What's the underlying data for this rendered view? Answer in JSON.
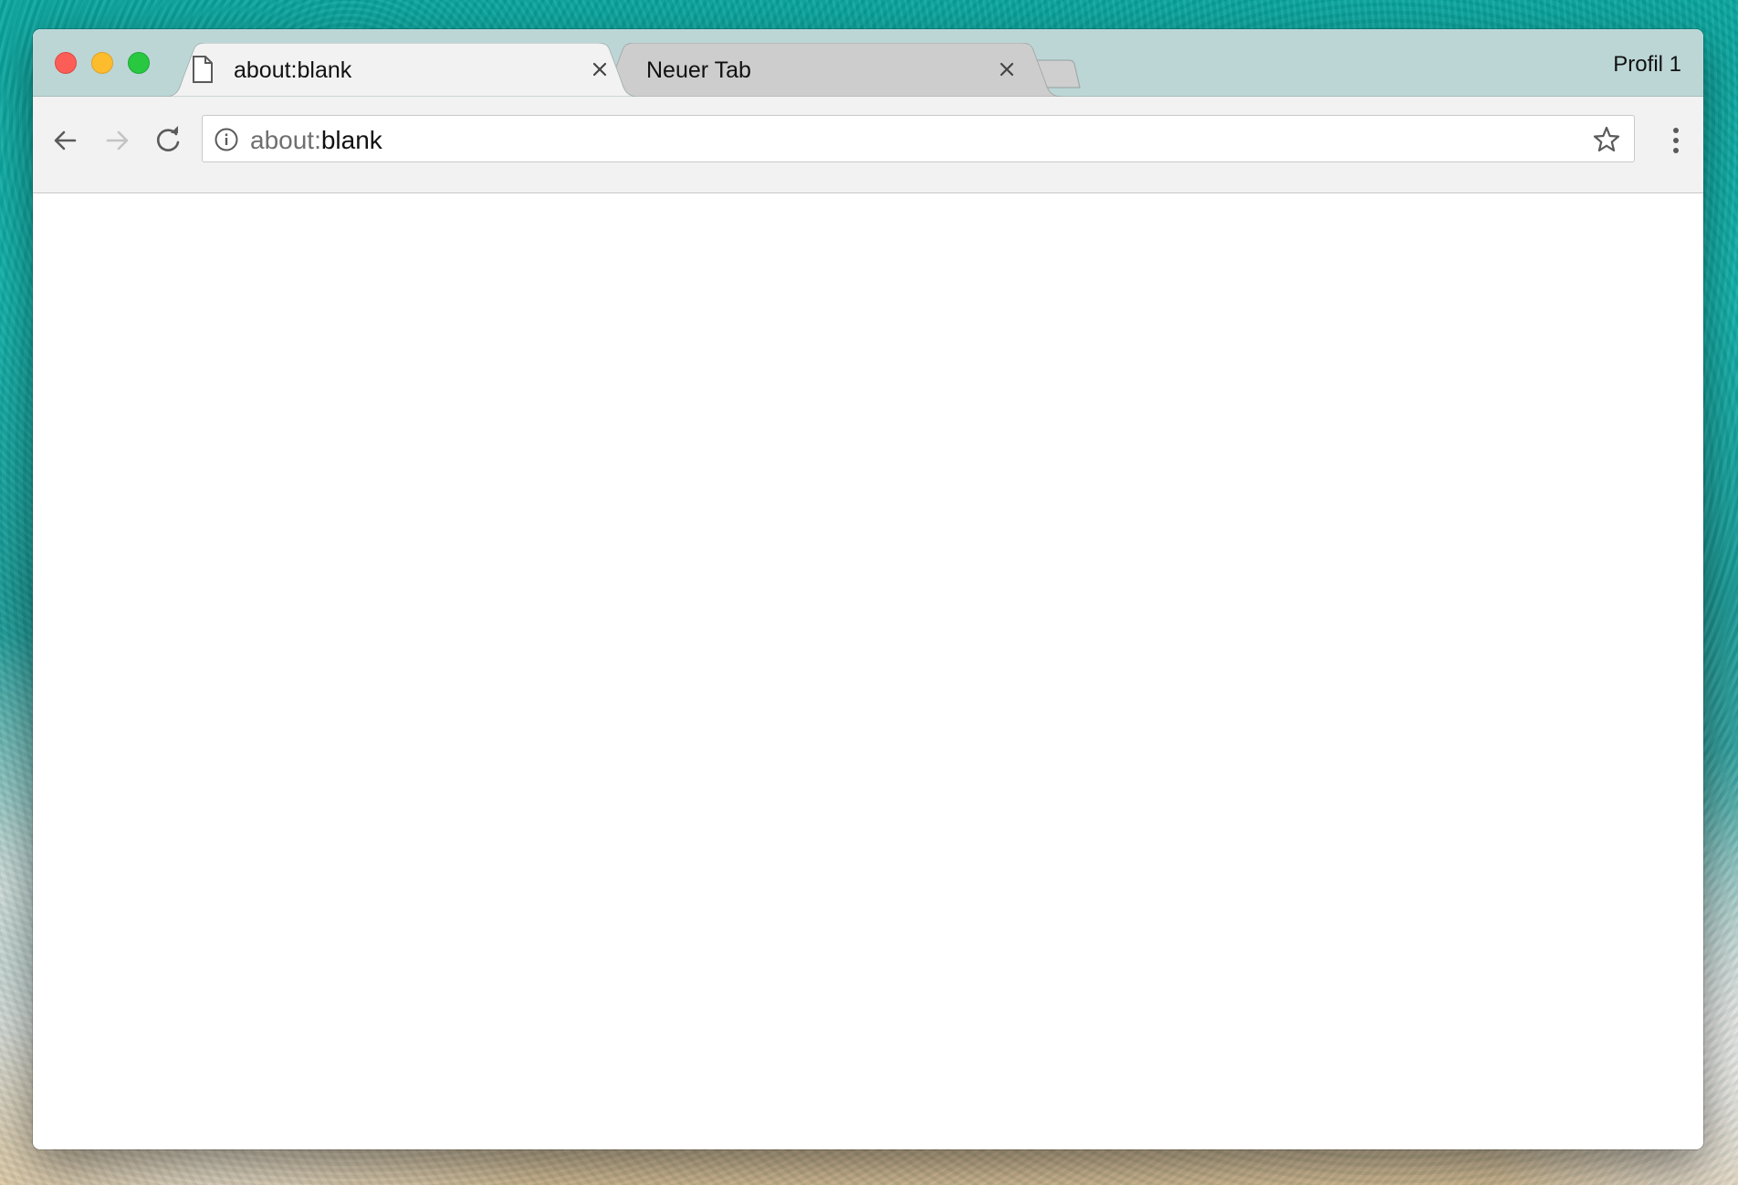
{
  "tabs": [
    {
      "title": "about:blank",
      "active": true,
      "favicon": "document-icon"
    },
    {
      "title": "Neuer Tab",
      "active": false
    }
  ],
  "profile": {
    "label": "Profil 1"
  },
  "omnibox": {
    "url_scheme": "about:",
    "url_rest": "blank",
    "security_icon": "info-icon",
    "bookmark_icon": "star-icon"
  },
  "toolbar": {
    "back_icon": "arrow-left-icon",
    "forward_icon": "arrow-right-icon",
    "reload_icon": "reload-icon",
    "menu_icon": "kebab-menu-icon"
  },
  "colors": {
    "titlebar": "#bcd6d6",
    "active_tab": "#f2f2f2",
    "inactive_tab": "#cdcdcd",
    "close_traffic": "#fc5e57",
    "minimize_traffic": "#fdbc2e",
    "maximize_traffic": "#28c840"
  }
}
